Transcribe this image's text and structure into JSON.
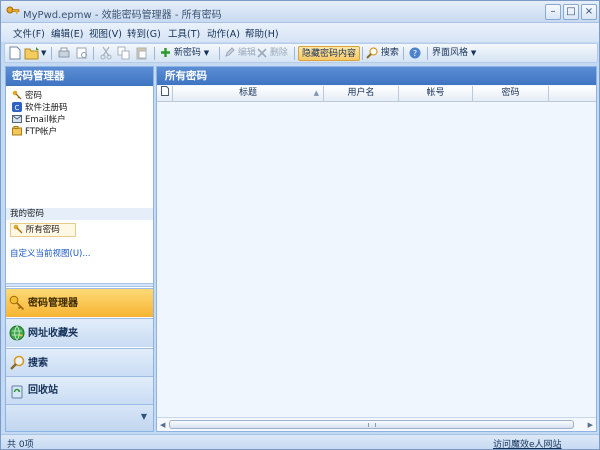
{
  "window": {
    "title": "MyPwd.epmw - 效能密码管理器 - 所有密码",
    "controls": {
      "minimize": "–",
      "maximize": "□",
      "close": "×"
    }
  },
  "menu": [
    "文件(F)",
    "编辑(E)",
    "视图(V)",
    "转到(G)",
    "工具(T)",
    "动作(A)",
    "帮助(H)"
  ],
  "toolbar": {
    "new_password": "新密码",
    "edit": "编辑",
    "delete": "删除",
    "hide_content": "隐藏密码内容",
    "search": "搜索",
    "theme": "界面风格"
  },
  "sidebar": {
    "header": "密码管理器",
    "tree": [
      "密码",
      "软件注册码",
      "Email帐户",
      "FTP帐户"
    ],
    "group_title": "我的密码",
    "selected": "所有密码",
    "customize_link": "自定义当前视图(U)...",
    "nav": [
      "密码管理器",
      "网址收藏夹",
      "搜索",
      "回收站"
    ]
  },
  "main": {
    "header": "所有密码",
    "columns": [
      "标题",
      "用户名",
      "帐号",
      "密码"
    ]
  },
  "status": {
    "count": "共 0项",
    "link": "访问魔效e人网站"
  },
  "colors": {
    "header_blue": "#4a80cc",
    "active_nav": "#f6b532",
    "highlight_button": "#f8c865"
  }
}
